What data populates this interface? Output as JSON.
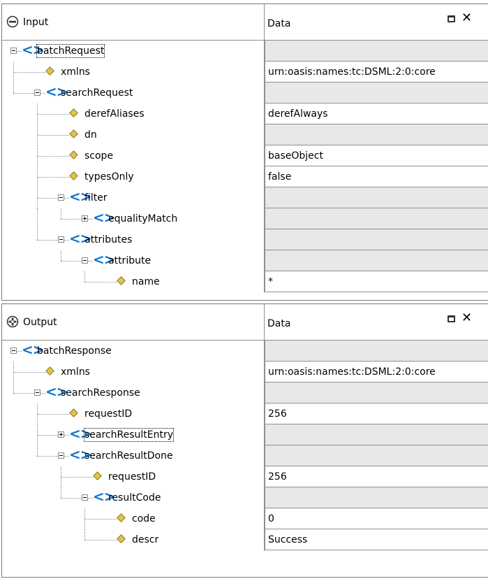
{
  "input": {
    "title": "Input",
    "data_header": "Data",
    "rows": [
      {
        "label": "batchRequest",
        "type": "element",
        "level": 0,
        "toggle": "minus",
        "value": "",
        "focus": true
      },
      {
        "label": "xmlns",
        "type": "attribute",
        "level": 1,
        "value": "urn:oasis:names:tc:DSML:2:0:core"
      },
      {
        "label": "searchRequest",
        "type": "element",
        "level": 1,
        "toggle": "minus",
        "value": ""
      },
      {
        "label": "derefAliases",
        "type": "attribute",
        "level": 2,
        "value": "derefAlways"
      },
      {
        "label": "dn",
        "type": "attribute",
        "level": 2,
        "value": ""
      },
      {
        "label": "scope",
        "type": "attribute",
        "level": 2,
        "value": "baseObject"
      },
      {
        "label": "typesOnly",
        "type": "attribute",
        "level": 2,
        "value": "false"
      },
      {
        "label": "filter",
        "type": "element",
        "level": 2,
        "toggle": "minus",
        "value": ""
      },
      {
        "label": "equalityMatch",
        "type": "element",
        "level": 3,
        "toggle": "plus",
        "value": ""
      },
      {
        "label": "attributes",
        "type": "element",
        "level": 2,
        "toggle": "minus",
        "value": ""
      },
      {
        "label": "attribute",
        "type": "element",
        "level": 3,
        "toggle": "minus",
        "value": ""
      },
      {
        "label": "name",
        "type": "attribute",
        "level": 4,
        "value": "*",
        "filled": true
      }
    ]
  },
  "output": {
    "title": "Output",
    "data_header": "Data",
    "rows": [
      {
        "label": "batchResponse",
        "type": "element",
        "level": 0,
        "toggle": "minus",
        "value": ""
      },
      {
        "label": "xmlns",
        "type": "attribute",
        "level": 1,
        "value": "urn:oasis:names:tc:DSML:2:0:core"
      },
      {
        "label": "searchResponse",
        "type": "element",
        "level": 1,
        "toggle": "minus",
        "value": ""
      },
      {
        "label": "requestID",
        "type": "attribute",
        "level": 2,
        "value": "256"
      },
      {
        "label": "searchResultEntry",
        "type": "element",
        "level": 2,
        "toggle": "plus",
        "value": "",
        "focus": true
      },
      {
        "label": "searchResultDone",
        "type": "element",
        "level": 2,
        "toggle": "minus",
        "value": ""
      },
      {
        "label": "requestID",
        "type": "attribute",
        "level": 3,
        "value": "256"
      },
      {
        "label": "resultCode",
        "type": "element",
        "level": 3,
        "toggle": "minus",
        "value": ""
      },
      {
        "label": "code",
        "type": "attribute",
        "level": 4,
        "value": "0"
      },
      {
        "label": "descr",
        "type": "attribute",
        "level": 4,
        "value": "Success"
      }
    ]
  },
  "icons": {
    "input_header": "minus-circle-icon",
    "output_header": "output-circle-icon",
    "element": "angle-brackets-icon",
    "attribute": "diamond-icon",
    "maximize": "maximize-icon",
    "close": "close-icon"
  },
  "colors": {
    "element_icon": "#1177cc",
    "attribute_icon": "#e0c44a",
    "empty_cell": "#e8e8e8"
  }
}
